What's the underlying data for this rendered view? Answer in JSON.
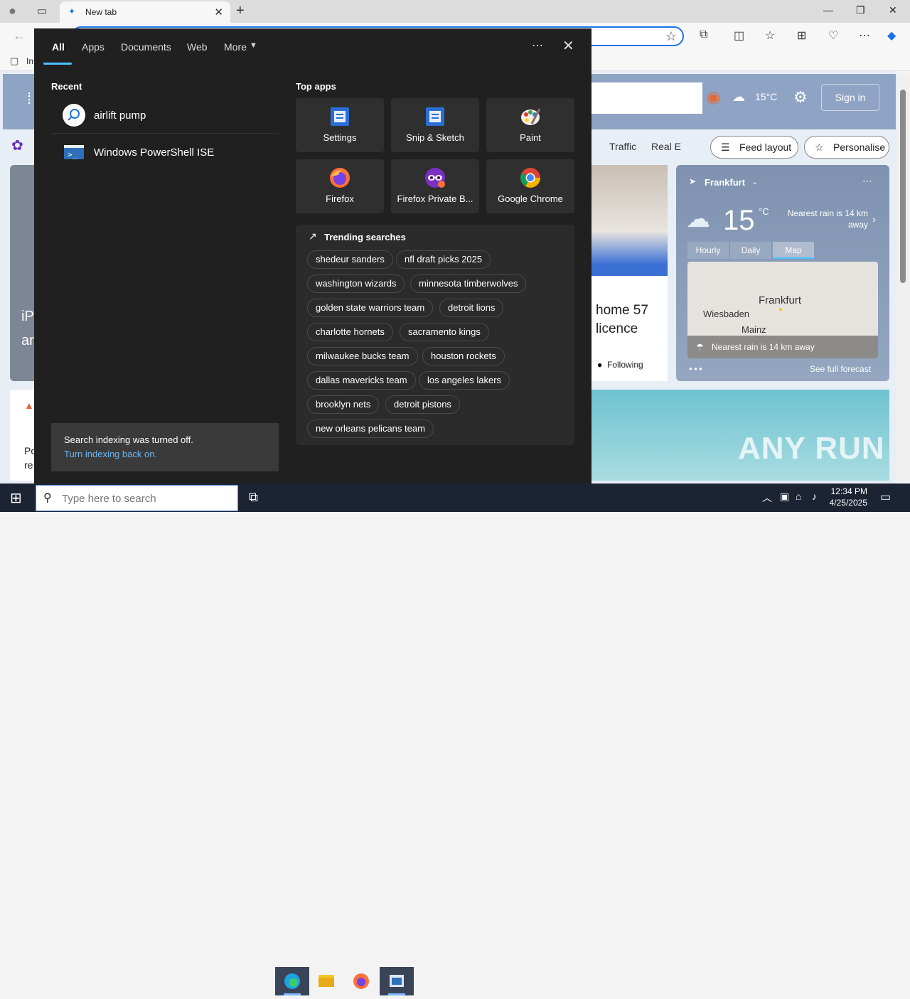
{
  "browser": {
    "tab_title": "New tab",
    "favbar_first": "In"
  },
  "page_bg": {
    "sign_in": "Sign in",
    "temperature": "15°C",
    "nav_links": [
      "Traffic",
      "Real E"
    ],
    "feed_layout": "Feed layout",
    "personalise": "Personalise",
    "article_headline": "home 57 licence",
    "article_follow": "Following",
    "left_text": "iP an",
    "left_text2": "Po re",
    "weather": {
      "city": "Frankfurt",
      "temp": "15",
      "unit": "°C",
      "nearest_rain": "Nearest rain is 14 km away",
      "tabs": [
        "Hourly",
        "Daily",
        "Map"
      ],
      "map_labels": [
        "Frankfurt",
        "Wiesbaden",
        "Mainz"
      ],
      "map_bar": "Nearest rain is 14 km away",
      "see_full": "See full forecast"
    },
    "watermark": "ANY RUN"
  },
  "search_panel": {
    "tabs": [
      "All",
      "Apps",
      "Documents",
      "Web",
      "More"
    ],
    "recent_header": "Recent",
    "recent": [
      "airlift pump",
      "Windows PowerShell ISE"
    ],
    "top_apps_header": "Top apps",
    "top_apps": [
      "Settings",
      "Snip & Sketch",
      "Paint",
      "Firefox",
      "Firefox Private B...",
      "Google Chrome"
    ],
    "trending_header": "Trending searches",
    "trending": [
      "shedeur sanders",
      "nfl draft picks 2025",
      "washington wizards",
      "minnesota timberwolves",
      "golden state warriors team",
      "detroit lions",
      "charlotte hornets",
      "sacramento kings",
      "milwaukee bucks team",
      "houston rockets",
      "dallas mavericks team",
      "los angeles lakers",
      "brooklyn nets",
      "detroit pistons",
      "new orleans pelicans team"
    ],
    "index_msg": "Search indexing was turned off.",
    "index_link": "Turn indexing back on."
  },
  "taskbar": {
    "search_placeholder": "Type here to search",
    "time": "12:34 PM",
    "date": "4/25/2025"
  }
}
